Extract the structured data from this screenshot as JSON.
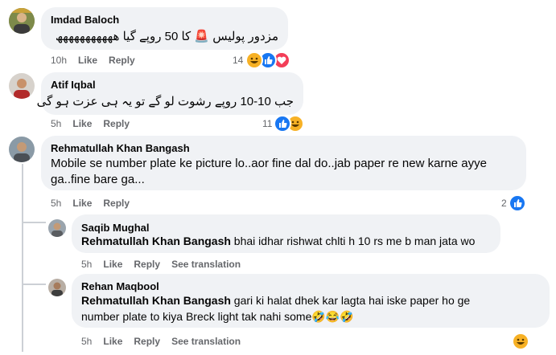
{
  "comments": [
    {
      "author": "Imdad Baloch",
      "text": "مزدور پولیس 🚨 کا 50 روپے گیا ھھھھھھھھھھھ",
      "time": "10h",
      "like": "Like",
      "reply": "Reply",
      "reaction_count": "14",
      "reactions": [
        "haha-icon",
        "like-icon",
        "love-icon"
      ]
    },
    {
      "author": "Atif Iqbal",
      "text": "جب 10-10 روپے رشوت لو گے تو یہ ہی عزت ہو گی",
      "time": "5h",
      "like": "Like",
      "reply": "Reply",
      "reaction_count": "11",
      "reactions": [
        "like-icon",
        "haha-icon"
      ]
    },
    {
      "author": "Rehmatullah Khan Bangash",
      "text_line1": "Mobile se number plate ke picture lo..aor fine dal do..jab paper re new karne ayye",
      "text_line2": "ga..fine bare ga...",
      "time": "5h",
      "like": "Like",
      "reply": "Reply",
      "reaction_count": "2",
      "reactions": [
        "like-icon"
      ]
    }
  ],
  "replies": [
    {
      "author": "Saqib Mughal",
      "mention": "Rehmatullah Khan Bangash",
      "text": " bhai idhar rishwat chlti h 10 rs me b man jata wo",
      "time": "5h",
      "like": "Like",
      "reply": "Reply",
      "translate": "See translation"
    },
    {
      "author": "Rehan Maqbool",
      "mention": "Rehmatullah Khan Bangash",
      "text_line1": " gari ki halat dhek kar lagta hai iske paper ho ge",
      "text_line2": "number plate to kiya Breck light tak nahi some🤣😂🤣",
      "time": "5h",
      "like": "Like",
      "reply": "Reply",
      "translate": "See translation",
      "reactions": [
        "haha-icon"
      ]
    }
  ]
}
